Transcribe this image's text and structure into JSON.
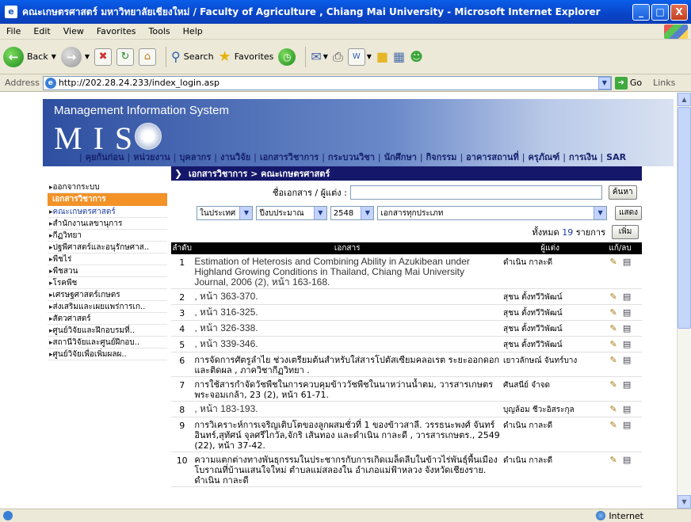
{
  "window": {
    "title": "คณะเกษตรศาสตร์ มหาวิทยาลัยเชียงใหม่ / Faculty of Agriculture , Chiang Mai University   - Microsoft Internet Explorer",
    "min": "_",
    "max": "□",
    "close": "X"
  },
  "menu": [
    "File",
    "Edit",
    "View",
    "Favorites",
    "Tools",
    "Help"
  ],
  "toolbar": {
    "back": "Back",
    "search": "Search",
    "favorites": "Favorites"
  },
  "address": {
    "label": "Address",
    "url": "http://202.28.24.233/index_login.asp",
    "go": "Go",
    "links": "Links"
  },
  "status": {
    "zone": "Internet"
  },
  "banner": {
    "title": "Management Information System",
    "mis": "MIS",
    "nav": [
      "คุยกันก่อน",
      "หน่วยงาน",
      "บุคลากร",
      "งานวิจัย",
      "เอกสารวิชาการ",
      "กระบวนวิชา",
      "นักศึกษา",
      "กิจกรรม",
      "อาคารสถานที่",
      "ครุภัณฑ์",
      "การเงิน",
      "SAR"
    ]
  },
  "sidebar": [
    {
      "label": "ออกจากระบบ",
      "kind": "item"
    },
    {
      "label": "เอกสารวิชาการ",
      "kind": "header"
    },
    {
      "label": "คณะเกษตรศาสตร์",
      "kind": "active"
    },
    {
      "label": "สำนักงานเลขานุการ",
      "kind": "item"
    },
    {
      "label": "กีฏวิทยา",
      "kind": "item"
    },
    {
      "label": "ปฐพีศาสตร์และอนุรักษศาส..",
      "kind": "item"
    },
    {
      "label": "พืชไร่",
      "kind": "item"
    },
    {
      "label": "พืชสวน",
      "kind": "item"
    },
    {
      "label": "โรคพืช",
      "kind": "item"
    },
    {
      "label": "เศรษฐศาสตร์เกษตร",
      "kind": "item"
    },
    {
      "label": "ส่งเสริมและเผยแพร่การเก..",
      "kind": "item"
    },
    {
      "label": "สัตวศาสตร์",
      "kind": "item"
    },
    {
      "label": "ศูนย์วิจัยและฝึกอบรมที่..",
      "kind": "item"
    },
    {
      "label": "สถานีวิจัยและศูนย์ฝึกอบ..",
      "kind": "item"
    },
    {
      "label": "ศูนย์วิจัยเพื่อเพิ่มผลผ..",
      "kind": "item"
    }
  ],
  "main": {
    "breadcrumb": "เอกสารวิชาการ > คณะเกษตรศาสตร์",
    "search_label": "ชื่อเอกสาร / ผู้แต่ง :",
    "search_value": "",
    "search_button": "ค้นหา",
    "filters": {
      "scope": "ในประเทศ",
      "year_type": "ปีงบประมาณ",
      "year": "2548",
      "doc_type": "เอกสารทุกประเภท"
    },
    "show_button": "แสดง",
    "count_prefix": "ทั้งหมด",
    "count": "19",
    "count_suffix": "รายการ",
    "add_button": "เพิ่ม",
    "columns": {
      "no": "ลำดับ",
      "doc": "เอกสาร",
      "author": "ผู้แต่ง",
      "action": "แก้/ลบ"
    },
    "rows": [
      {
        "no": "1",
        "doc": "Estimation of Heterosis and Combining Ability in Azukibean under Highland Growing Conditions in Thailand, Chiang Mai University Journal, 2006 (2), หน้า 163-168.",
        "author": "ดำเนิน กาละดี",
        "en": true
      },
      {
        "no": "2",
        "doc": ", หน้า 363-370.",
        "author": "สุชน ตั้งทวีวิพัฒน์",
        "en": true
      },
      {
        "no": "3",
        "doc": ", หน้า 316-325.",
        "author": "สุชน ตั้งทวีวิพัฒน์",
        "en": true
      },
      {
        "no": "4",
        "doc": ", หน้า 326-338.",
        "author": "สุชน ตั้งทวีวิพัฒน์",
        "en": true
      },
      {
        "no": "5",
        "doc": ", หน้า 339-346.",
        "author": "สุชน ตั้งทวีวิพัฒน์",
        "en": true
      },
      {
        "no": "6",
        "doc": "การจัดการศัตรูลำไย ช่วงเตรียมต้นสำหรับใส่สารโปตัสเซียมคลอเรต ระยะออกดอก และติดผล , ภาควิชากีฏวิทยา .",
        "author": "เยาวลักษณ์ จันทร์บาง",
        "en": false
      },
      {
        "no": "7",
        "doc": "การใช้สารกำจัดวัชพืชในการควบคุมข้าววัชพืชในนาหว่านน้ำตม, วารสารเกษตรพระจอมเกล้า, 23 (2), หน้า 61-71.",
        "author": "ศันสนีย์ จำจด",
        "en": false
      },
      {
        "no": "8",
        "doc": ", หน้า 183-193.",
        "author": "บุญล้อม ชีวะอิสระกุล",
        "en": true
      },
      {
        "no": "9",
        "doc": "การวิเคราะห์การเจริญเติบโตของลูกผสมชั่วที่ 1 ของข้าวสาลี. วรรธนะพงศ์ จันทร์อินทร์,สุทัศน์ จุลศรีไกวัล,จักริ เส้นทอง และดำเนิน กาละดี , วารสารเกษตร., 2549 (22), หน้า 37-42.",
        "author": "ดำเนิน กาละดี",
        "en": false
      },
      {
        "no": "10",
        "doc": "ความแตกต่างทางพันธุกรรมในประชากรกับการเกิดเมล็ดลีบในข้าวไร่พันธุ์พื้นเมืองโบราณที่บ้านแสนใจใหม่ ตำบลแม่สลองใน อำเภอแม่ฟ้าหลวง จังหวัดเชียงราย. ดำเนิน กาละดี",
        "author": "ดำเนิน กาละดี",
        "en": false
      }
    ]
  }
}
